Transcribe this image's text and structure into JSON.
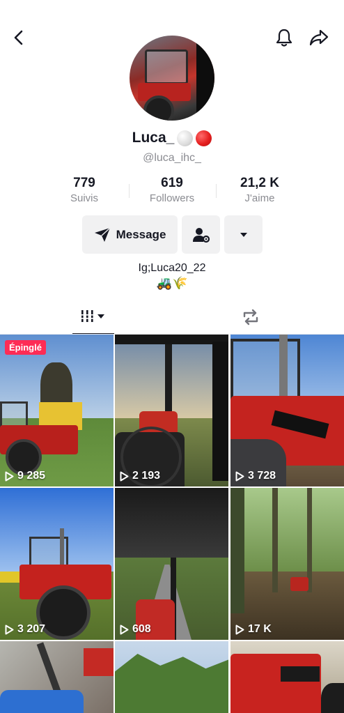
{
  "profile": {
    "display_name": "Luca_",
    "handle": "@luca_ihc_",
    "bio_line1": "Ig;Luca20_22",
    "bio_emoji": "🚜🌾"
  },
  "stats": [
    {
      "value": "779",
      "label": "Suivis"
    },
    {
      "value": "619",
      "label": "Followers"
    },
    {
      "value": "21,2 K",
      "label": "J'aime"
    }
  ],
  "actions": {
    "message_label": "Message"
  },
  "videos": [
    {
      "views": "9 285",
      "pinned_label": "Épinglé"
    },
    {
      "views": "2 193"
    },
    {
      "views": "3 728"
    },
    {
      "views": "3 207"
    },
    {
      "views": "608"
    },
    {
      "views": "17 K"
    },
    {
      "views": ""
    },
    {
      "views": ""
    },
    {
      "views": ""
    }
  ],
  "colors": {
    "accent": "#fe2c55",
    "button_bg": "#f1f1f2",
    "secondary_text": "#8a8b91"
  },
  "icons": [
    "back-arrow-icon",
    "bell-icon",
    "share-icon",
    "send-icon",
    "add-user-settings-icon",
    "chevron-down-icon",
    "grid-icon",
    "repost-icon",
    "play-icon"
  ]
}
